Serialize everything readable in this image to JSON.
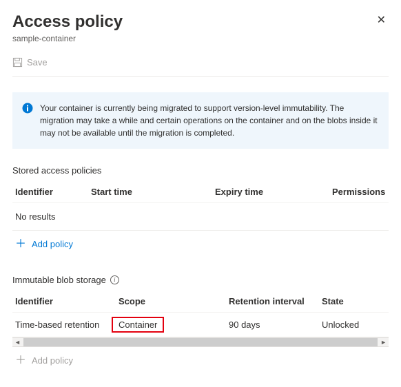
{
  "header": {
    "title": "Access policy",
    "subtitle": "sample-container"
  },
  "toolbar": {
    "save_label": "Save"
  },
  "info": {
    "message": "Your container is currently being migrated to support version-level immutability. The migration may take a while and certain operations on the container and on the blobs inside it may not be available until the migration is completed."
  },
  "stored_access_policies": {
    "section_title": "Stored access policies",
    "columns": {
      "identifier": "Identifier",
      "start_time": "Start time",
      "expiry_time": "Expiry time",
      "permissions": "Permissions"
    },
    "no_results": "No results",
    "add_label": "Add policy"
  },
  "immutable_blob_storage": {
    "section_title": "Immutable blob storage",
    "columns": {
      "identifier": "Identifier",
      "scope": "Scope",
      "retention_interval": "Retention interval",
      "state": "State"
    },
    "row": {
      "identifier": "Time-based retention",
      "scope": "Container",
      "retention_interval": "90 days",
      "state": "Unlocked"
    },
    "add_label": "Add policy"
  }
}
